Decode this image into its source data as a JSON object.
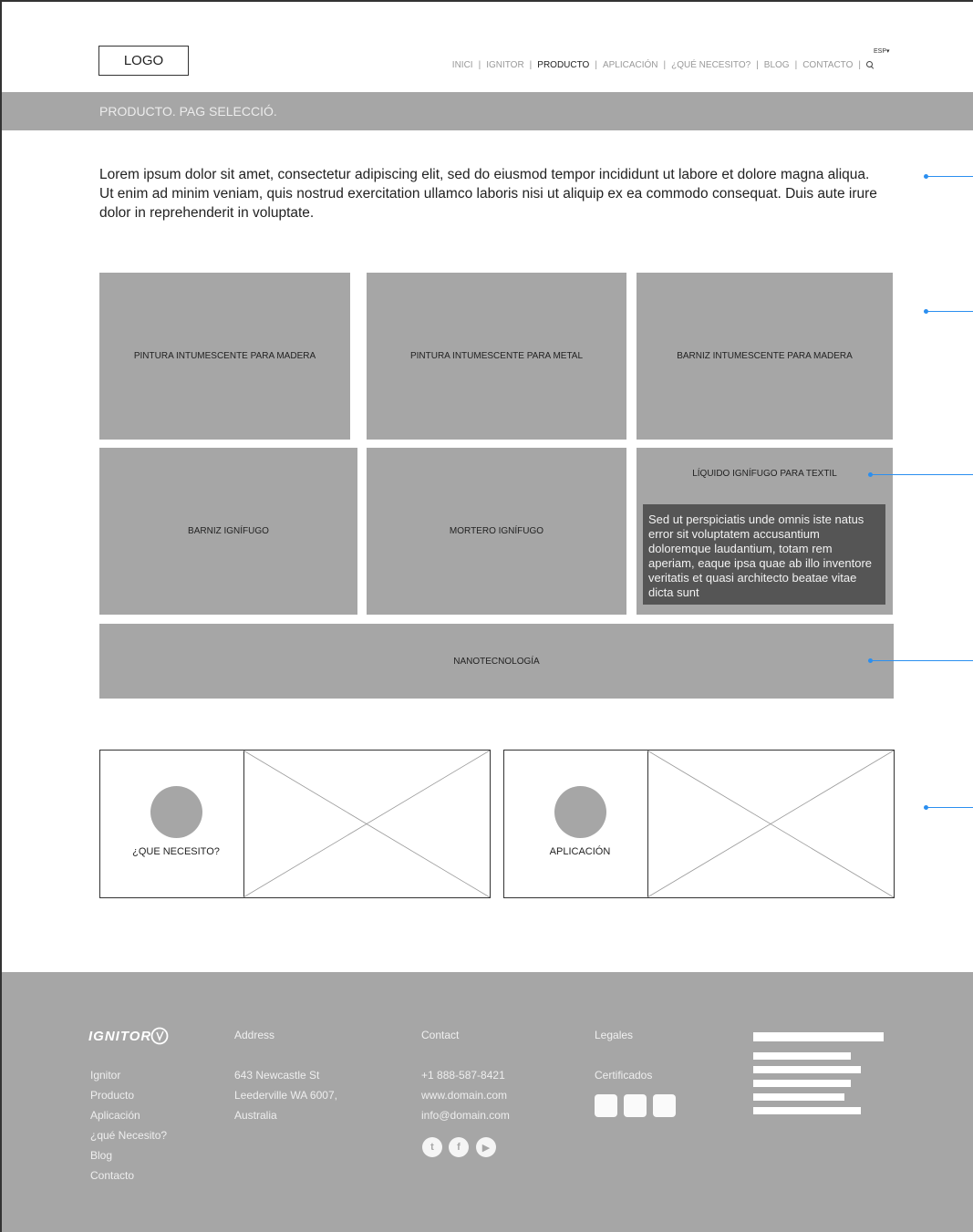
{
  "header": {
    "logo": "LOGO",
    "lang": "ESP",
    "nav": [
      {
        "label": "INICI",
        "active": false
      },
      {
        "label": "IGNITOR",
        "active": false
      },
      {
        "label": "PRODUCTO",
        "active": true
      },
      {
        "label": "APLICACIÓN",
        "active": false
      },
      {
        "label": "¿QUÉ NECESITO?",
        "active": false
      },
      {
        "label": "BLOG",
        "active": false
      },
      {
        "label": "CONTACTO",
        "active": false
      }
    ]
  },
  "banner": {
    "title": "PRODUCTO. PAG SELECCIÓ."
  },
  "intro": "Lorem ipsum dolor sit amet, consectetur adipiscing elit, sed do eiusmod tempor incididunt ut labore et dolore magna aliqua. Ut enim ad minim veniam, quis nostrud exercitation ullamco laboris nisi ut aliquip ex ea commodo consequat. Duis aute irure dolor in reprehenderit in voluptate.",
  "products": [
    "PINTURA INTUMESCENTE PARA MADERA",
    "PINTURA INTUMESCENTE PARA METAL",
    "BARNIZ INTUMESCENTE PARA MADERA",
    "BARNIZ IGNÍFUGO",
    "MORTERO IGNÍFUGO",
    "LÍQUIDO IGNÍFUGO PARA TEXTIL",
    "NANOTECNOLOGÍA"
  ],
  "tooltip": "Sed ut perspiciatis unde omnis iste natus error sit voluptatem accusantium doloremque laudantium, totam rem aperiam, eaque ipsa quae ab illo inventore veritatis et quasi architecto beatae vitae dicta sunt",
  "cards": [
    {
      "label": "¿QUE NECESITO?"
    },
    {
      "label": "APLICACIÓN"
    }
  ],
  "footer": {
    "brand": "IGNITOR",
    "links": [
      "Ignitor",
      "Producto",
      "Aplicación",
      "¿qué Necesito?",
      "Blog",
      "Contacto"
    ],
    "address": {
      "title": "Address",
      "lines": [
        "643 Newcastle St",
        "Leederville WA 6007,",
        "Australia"
      ]
    },
    "contact": {
      "title": "Contact",
      "lines": [
        "+1 888-587-8421",
        "www.domain.com",
        "info@domain.com"
      ]
    },
    "legales": {
      "title": "Legales",
      "certificados": "Certificados"
    },
    "social": [
      {
        "icon": "twitter-icon",
        "glyph": "t"
      },
      {
        "icon": "facebook-icon",
        "glyph": "f"
      },
      {
        "icon": "youtube-icon",
        "glyph": "▶"
      }
    ]
  },
  "colors": {
    "tile": "#a6a6a6",
    "tooltip": "#555555",
    "annotation": "#2b8ff0"
  }
}
